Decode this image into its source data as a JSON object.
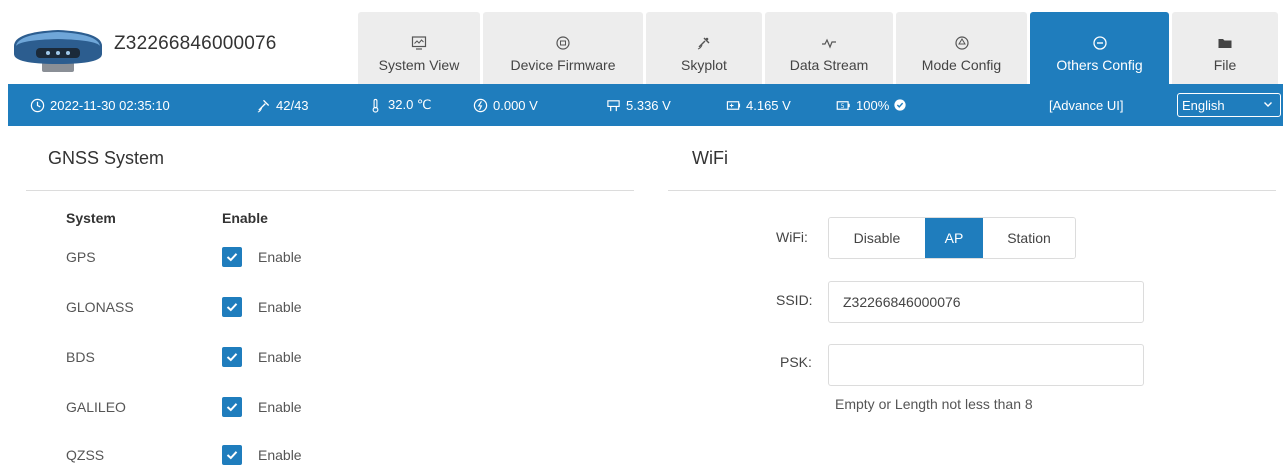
{
  "header": {
    "device_serial": "Z32266846000076",
    "device_image": "gnss-receiver-image",
    "tabs": [
      {
        "label": "System View",
        "icon": "monitor-icon",
        "active": false
      },
      {
        "label": "Device Firmware",
        "icon": "firmware-icon",
        "active": false
      },
      {
        "label": "Skyplot",
        "icon": "satellite-icon",
        "active": false
      },
      {
        "label": "Data Stream",
        "icon": "data-stream-icon",
        "active": false
      },
      {
        "label": "Mode Config",
        "icon": "mode-config-icon",
        "active": false
      },
      {
        "label": "Others Config",
        "icon": "others-config-icon",
        "active": true
      },
      {
        "label": "File",
        "icon": "folder-icon",
        "active": false
      }
    ]
  },
  "status": {
    "datetime": "2022-11-30 02:35:10",
    "satellites": "42/43",
    "temperature": "32.0 ℃",
    "voltage_1": "0.000 V",
    "voltage_2": "5.336 V",
    "voltage_3": "4.165 V",
    "battery": "100%",
    "advance_ui": "[Advance UI]",
    "language": "English"
  },
  "gnss": {
    "title": "GNSS System",
    "col_system": "System",
    "col_enable": "Enable",
    "rows": [
      {
        "name": "GPS",
        "enable": "Enable",
        "checked": true
      },
      {
        "name": "GLONASS",
        "enable": "Enable",
        "checked": true
      },
      {
        "name": "BDS",
        "enable": "Enable",
        "checked": true
      },
      {
        "name": "GALILEO",
        "enable": "Enable",
        "checked": true
      },
      {
        "name": "QZSS",
        "enable": "Enable",
        "checked": true
      }
    ]
  },
  "wifi": {
    "title": "WiFi",
    "mode_label": "WiFi:",
    "modes": [
      "Disable",
      "AP",
      "Station"
    ],
    "selected_mode": "AP",
    "ssid_label": "SSID:",
    "ssid_value": "Z32266846000076",
    "psk_label": "PSK:",
    "psk_value": "",
    "psk_hint": "Empty or Length not less than 8"
  },
  "colors": {
    "accent": "#1f7dbd",
    "tab_bg": "#ededed",
    "divider": "#dcdcdc"
  }
}
